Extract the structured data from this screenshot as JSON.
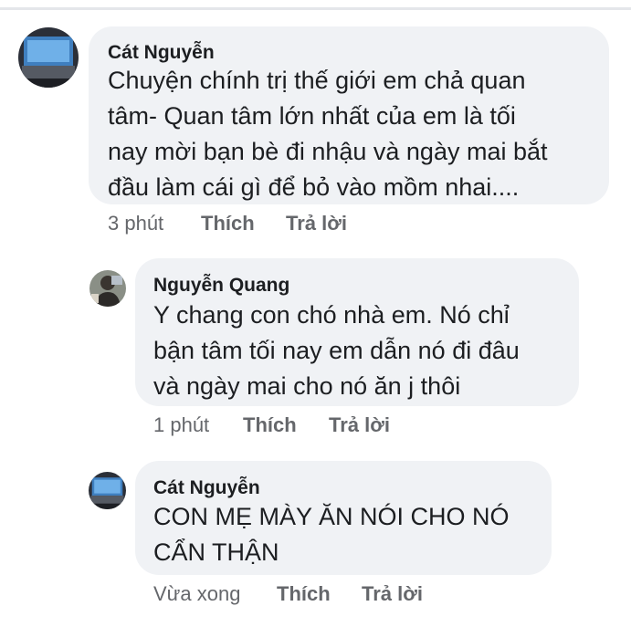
{
  "comments": [
    {
      "author": "Cát Nguyễn",
      "lines": [
        "Chuyện chính trị thế giới em chả quan",
        "tâm- Quan tâm lớn nhất của em là tối",
        "nay mời bạn bè đi nhậu và ngày mai bắt",
        "đầu làm cái gì để bỏ vào mồm nhai...."
      ],
      "time": "3 phút",
      "like_label": "Thích",
      "reply_label": "Trả lời"
    },
    {
      "author": "Nguyễn Quang",
      "lines": [
        "Y chang con chó nhà em. Nó chỉ",
        "bận tâm tối nay em dẫn nó đi đâu",
        "và ngày mai cho nó ăn j thôi"
      ],
      "time": "1 phút",
      "like_label": "Thích",
      "reply_label": "Trả lời"
    },
    {
      "author": "Cát Nguyễn",
      "lines": [
        "CON MẸ MÀY ĂN NÓI CHO NÓ",
        "CẨN THẬN"
      ],
      "time": "Vừa xong",
      "like_label": "Thích",
      "reply_label": "Trả lời"
    }
  ],
  "colors": {
    "bubble": "#f0f2f5",
    "text": "#1c1e21",
    "meta": "#65676b"
  },
  "icons": [
    "avatar-laptop-icon",
    "avatar-person-icon"
  ]
}
